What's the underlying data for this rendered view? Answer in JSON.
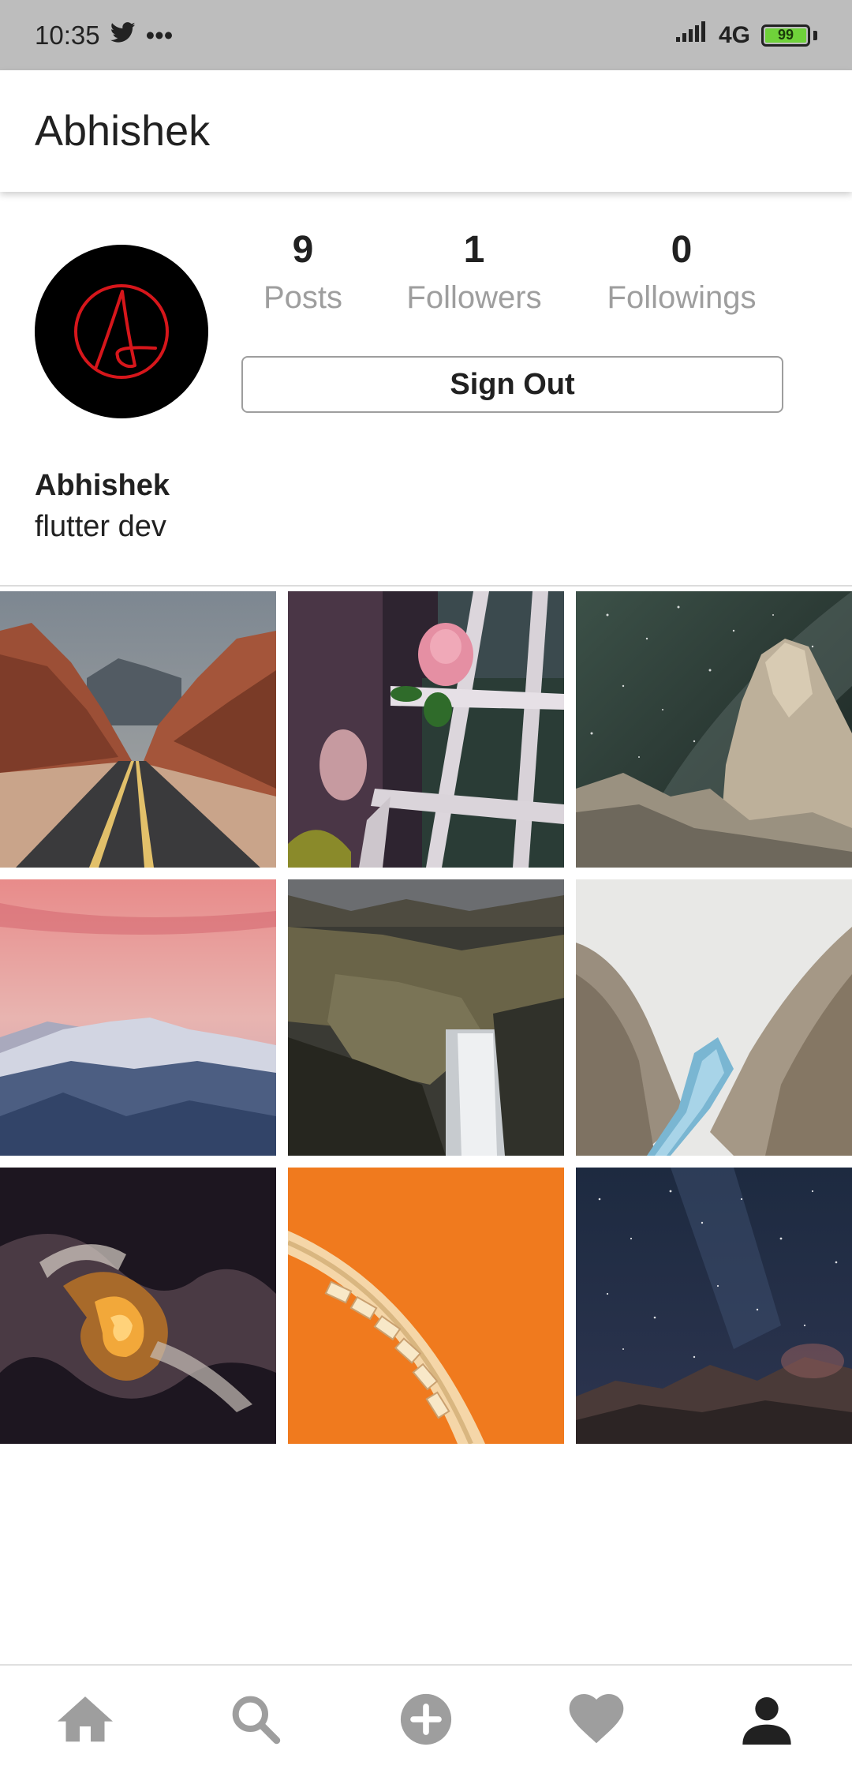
{
  "status_bar": {
    "time": "10:35",
    "more": "•••",
    "network": "4G",
    "battery": "99"
  },
  "app_bar": {
    "title": "Abhishek"
  },
  "profile": {
    "stats": [
      {
        "value": "9",
        "label": "Posts"
      },
      {
        "value": "1",
        "label": "Followers"
      },
      {
        "value": "0",
        "label": "Followings"
      }
    ],
    "sign_out_label": "Sign Out",
    "name": "Abhishek",
    "bio": "flutter dev"
  },
  "colors": {
    "status_bar_bg": "#bdbdbd",
    "nav_inactive": "#9e9e9e",
    "nav_active": "#212121",
    "avatar_bg": "#000000",
    "avatar_mark": "#d6161b"
  },
  "nav": [
    {
      "icon": "home-icon"
    },
    {
      "icon": "search-icon"
    },
    {
      "icon": "add-post-icon"
    },
    {
      "icon": "heart-icon"
    },
    {
      "icon": "profile-icon",
      "active": true
    }
  ]
}
